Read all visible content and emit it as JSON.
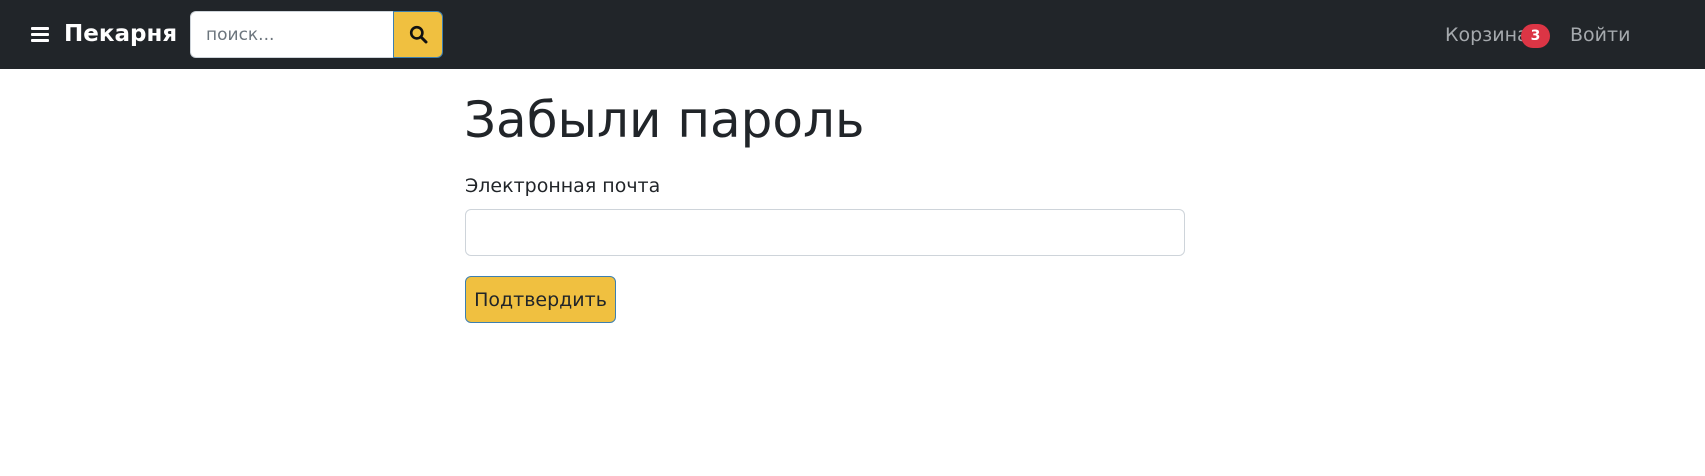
{
  "navbar": {
    "brand": "Пекарня",
    "search": {
      "placeholder": "поиск...",
      "value": ""
    },
    "cart": {
      "label": "Корзина",
      "badge_count": "3"
    },
    "login": {
      "label": "Войти"
    }
  },
  "main": {
    "title": "Забыли пароль",
    "email_label": "Электронная почта",
    "email_value": "",
    "submit_label": "Подтвердить"
  },
  "colors": {
    "navbar_bg": "#212529",
    "accent": "#f0c040",
    "badge": "#dc3545",
    "nav_link": "#a5a9ad"
  },
  "icons": {
    "menu": "menu-icon",
    "search": "search-icon"
  }
}
